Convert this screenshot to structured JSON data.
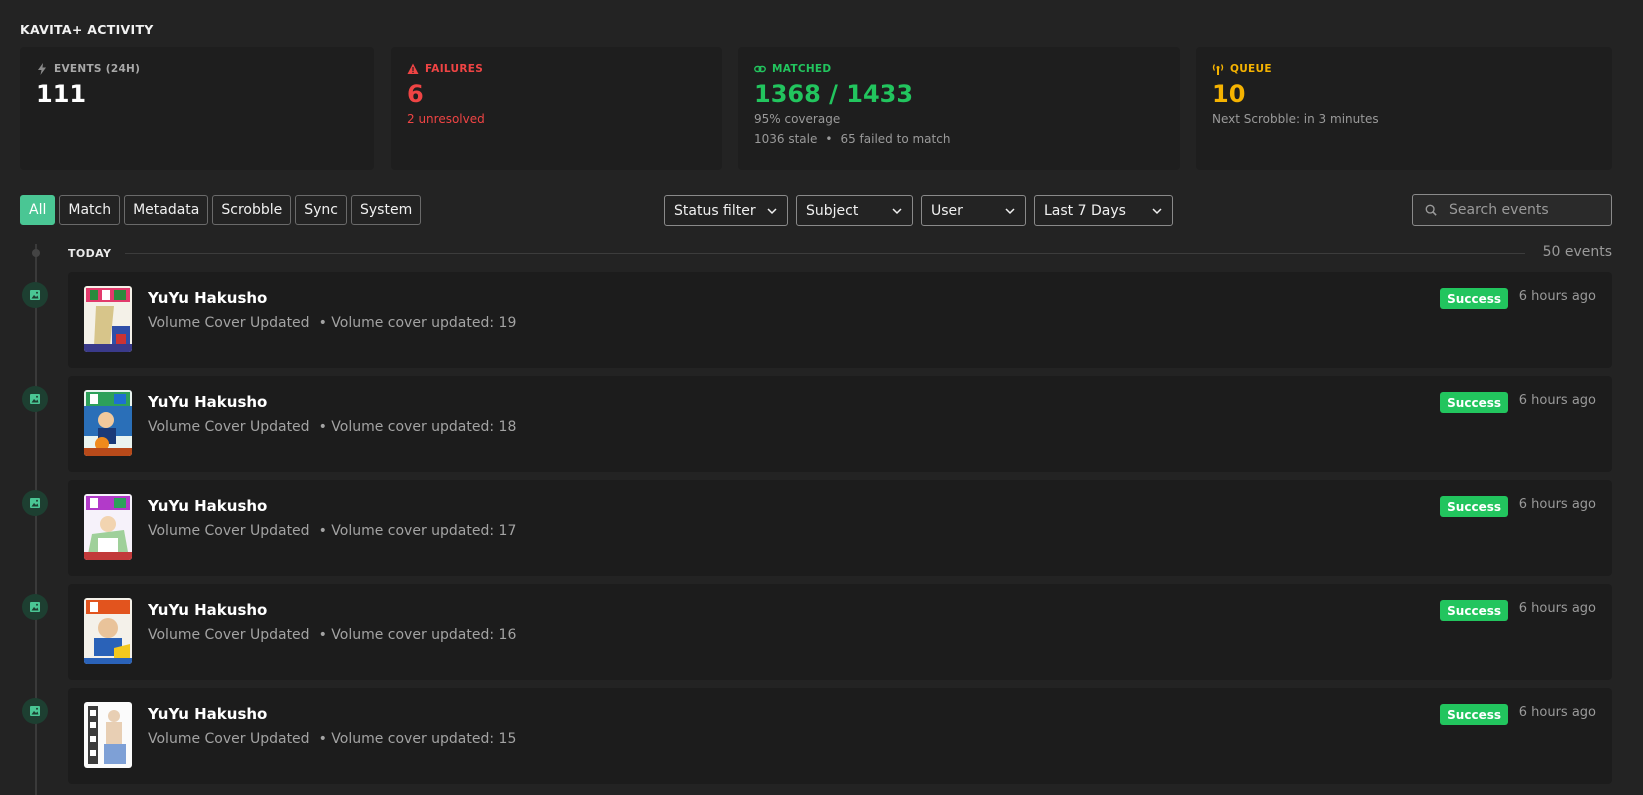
{
  "page_title": "KAVITA+ ACTIVITY",
  "stats": {
    "events": {
      "label": "EVENTS (24H)",
      "value": "111"
    },
    "failures": {
      "label": "FAILURES",
      "value": "6",
      "sub": "2 unresolved"
    },
    "matched": {
      "label": "MATCHED",
      "value": "1368 / 1433",
      "sub": "95% coverage",
      "stale": "1036 stale",
      "sep": "•",
      "failed": "65 failed to match"
    },
    "queue": {
      "label": "QUEUE",
      "value": "10",
      "sub": "Next Scrobble: in 3 minutes"
    }
  },
  "filters": {
    "chips": [
      "All",
      "Match",
      "Metadata",
      "Scrobble",
      "Sync",
      "System"
    ],
    "active_chip": "All",
    "status": "Status filter",
    "subject": "Subject",
    "user": "User",
    "range": "Last 7 Days"
  },
  "search": {
    "placeholder": "Search events"
  },
  "timeline": {
    "day_label": "TODAY",
    "count": "50 events",
    "events": [
      {
        "title": "YuYu Hakusho",
        "type": "Volume Cover Updated",
        "detail": "• Volume cover updated: 19",
        "status": "Success",
        "time": "6 hours ago"
      },
      {
        "title": "YuYu Hakusho",
        "type": "Volume Cover Updated",
        "detail": "• Volume cover updated: 18",
        "status": "Success",
        "time": "6 hours ago"
      },
      {
        "title": "YuYu Hakusho",
        "type": "Volume Cover Updated",
        "detail": "• Volume cover updated: 17",
        "status": "Success",
        "time": "6 hours ago"
      },
      {
        "title": "YuYu Hakusho",
        "type": "Volume Cover Updated",
        "detail": "• Volume cover updated: 16",
        "status": "Success",
        "time": "6 hours ago"
      },
      {
        "title": "YuYu Hakusho",
        "type": "Volume Cover Updated",
        "detail": "• Volume cover updated: 15",
        "status": "Success",
        "time": "6 hours ago"
      }
    ]
  },
  "colors": {
    "accent": "#4ac694",
    "failure": "#ef4444",
    "matched": "#22c55e",
    "queue": "#f5b301",
    "success_badge": "#22c55e"
  },
  "icons": {
    "events": "bolt-icon",
    "failures": "warning-triangle-icon",
    "matched": "link-icon",
    "queue": "broadcast-icon",
    "event_marker": "image-icon",
    "search": "search-icon",
    "dropdown": "chevron-down-icon"
  }
}
